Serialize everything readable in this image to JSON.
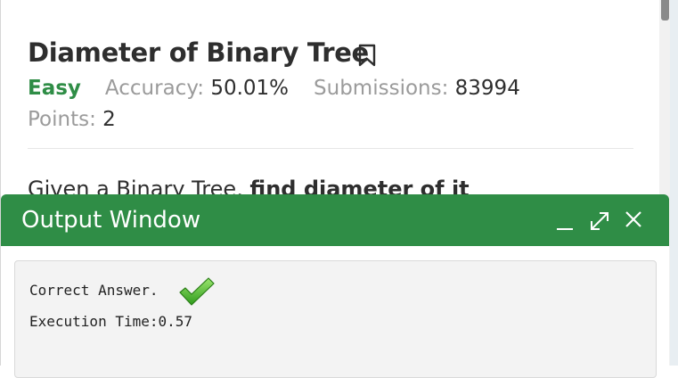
{
  "problem": {
    "title": "Diameter of Binary Tree",
    "difficulty": "Easy",
    "accuracy_label": "Accuracy:",
    "accuracy_value": "50.01%",
    "submissions_label": "Submissions:",
    "submissions_value": "83994",
    "points_label": "Points:",
    "points_value": "2",
    "description_start": "Given a Binary Tree, ",
    "description_bold": "find diameter of it"
  },
  "output_window": {
    "title": "Output Window",
    "result_text": "Correct Answer.",
    "execution_time": "Execution Time:0.57"
  },
  "icons": {
    "bookmark": "bookmark-icon",
    "minimize": "minimize-icon",
    "expand": "expand-icon",
    "close": "close-icon",
    "success": "checkmark-icon"
  },
  "colors": {
    "accent_green": "#2f8d46",
    "easy_green": "#2f8d46",
    "check_green": "#3fb02a"
  }
}
